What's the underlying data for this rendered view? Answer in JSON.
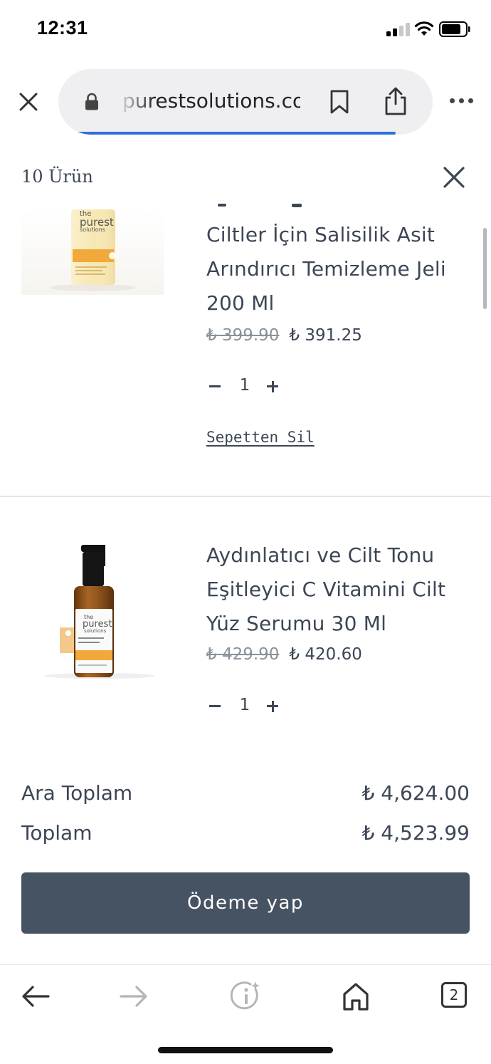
{
  "status_bar": {
    "time": "12:31"
  },
  "browser": {
    "url": "purestsolutions.com",
    "tab_count": "2"
  },
  "cart": {
    "item_count_label": "10 Ürün",
    "items": [
      {
        "title": "Ciltler İçin Salisilik Asit Arındırıcı Temizleme Jeli 200 Ml",
        "old_price": "₺ 399.90",
        "new_price": "₺ 391.25",
        "quantity": "1",
        "remove_label": "Sepetten Sil",
        "image_brand": {
          "small": "the",
          "big": "purest",
          "sub": "solutions"
        }
      },
      {
        "title": "Aydınlatıcı ve Cilt Tonu Eşitleyici C Vitamini Cilt Yüz Serumu 30 Ml",
        "old_price": "₺ 429.90",
        "new_price": "₺ 420.60",
        "quantity": "1",
        "image_brand": {
          "small": "the",
          "big": "purest",
          "sub": "solutions"
        }
      }
    ],
    "subtotal_label": "Ara Toplam",
    "subtotal_value": "₺ 4,624.00",
    "total_label": "Toplam",
    "total_value": "₺ 4,523.99",
    "checkout_label": "Ödeme yap"
  },
  "icons": {
    "close": "close-icon",
    "lock": "lock-icon",
    "bookmark": "bookmark-icon",
    "share": "share-icon",
    "more": "more-icon",
    "back": "back-arrow-icon",
    "forward": "forward-arrow-icon",
    "info": "info-icon",
    "home": "home-icon"
  },
  "colors": {
    "text": "#3c4655",
    "checkout_bg": "#465362",
    "load_bar": "#2f6fe0",
    "brand_orange": "#f2a93b"
  }
}
